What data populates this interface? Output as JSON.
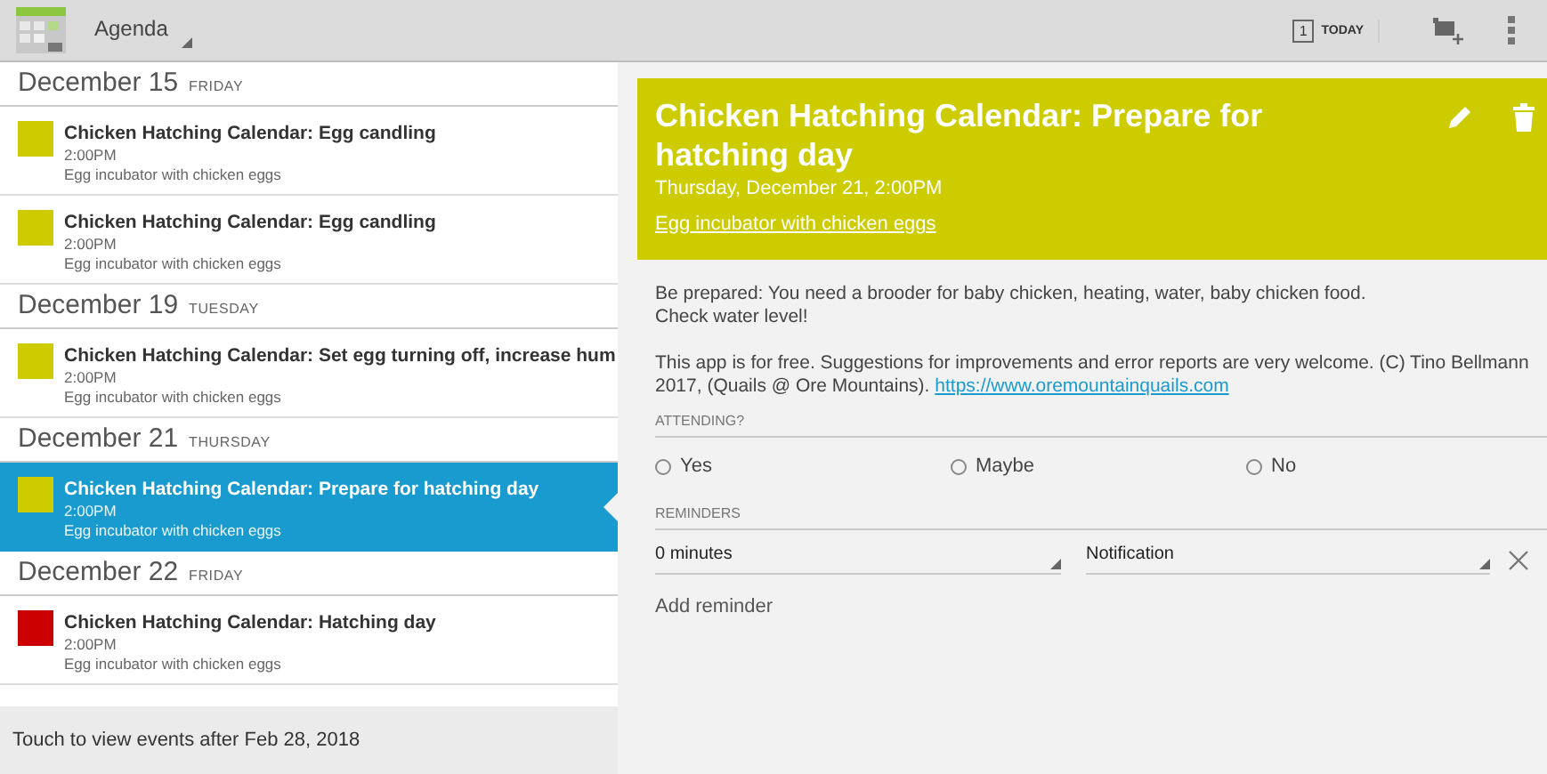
{
  "toolbar": {
    "view": "Agenda",
    "today_day": "1",
    "today_label": "TODAY"
  },
  "agenda": {
    "days": [
      {
        "date": "December 15",
        "weekday": "FRIDAY",
        "events": [
          {
            "title": "Chicken Hatching Calendar: Egg candling",
            "time": "2:00PM",
            "calendar": "Egg incubator with chicken eggs",
            "color": "#cccc00",
            "selected": false
          },
          {
            "title": "Chicken Hatching Calendar: Egg candling",
            "time": "2:00PM",
            "calendar": "Egg incubator with chicken eggs",
            "color": "#cccc00",
            "selected": false
          }
        ]
      },
      {
        "date": "December 19",
        "weekday": "TUESDAY",
        "events": [
          {
            "title": "Chicken Hatching Calendar: Set egg turning off, increase hum",
            "time": "2:00PM",
            "calendar": "Egg incubator with chicken eggs",
            "color": "#cccc00",
            "selected": false
          }
        ]
      },
      {
        "date": "December 21",
        "weekday": "THURSDAY",
        "events": [
          {
            "title": "Chicken Hatching Calendar: Prepare for hatching day",
            "time": "2:00PM",
            "calendar": "Egg incubator with chicken eggs",
            "color": "#cccc00",
            "selected": true
          }
        ]
      },
      {
        "date": "December 22",
        "weekday": "FRIDAY",
        "events": [
          {
            "title": "Chicken Hatching Calendar: Hatching day",
            "time": "2:00PM",
            "calendar": "Egg incubator with chicken eggs",
            "color": "#cc0000",
            "selected": false
          }
        ]
      }
    ],
    "footer": "Touch to view events after Feb 28, 2018"
  },
  "detail": {
    "title": "Chicken Hatching Calendar: Prepare for hatching day",
    "color": "#cccc00",
    "when": "Thursday, December 21, 2:00PM",
    "calendar": "Egg incubator with chicken eggs",
    "description": {
      "lines": [
        "Be prepared: You need a brooder for baby chicken, heating, water, baby chicken food.",
        "Check water level!"
      ],
      "note": "This app is for free. Suggestions for improvements and error reports are very welcome. (C) Tino Bellmann 2017, (Quails @ Ore Mountains).",
      "link": "https://www.oremountainquails.com"
    },
    "attending": {
      "label": "ATTENDING?",
      "options": [
        {
          "label": "Yes",
          "selected": false
        },
        {
          "label": "Maybe",
          "selected": false
        },
        {
          "label": "No",
          "selected": false
        }
      ]
    },
    "reminders": {
      "label": "REMINDERS",
      "items": [
        {
          "time": "0 minutes",
          "method": "Notification"
        }
      ],
      "add": "Add reminder"
    }
  }
}
